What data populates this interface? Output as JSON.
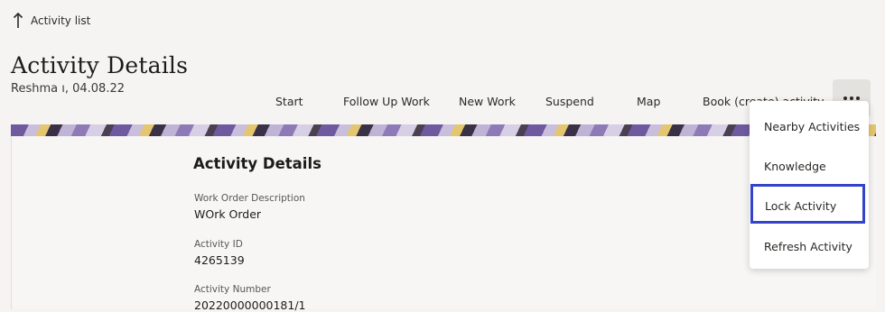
{
  "nav": {
    "up_label": "Activity list"
  },
  "header": {
    "title": "Activity Details",
    "subtitle": "Reshma ı, 04.08.22"
  },
  "actions": {
    "start": "Start",
    "follow_up": "Follow Up Work",
    "new_work": "New Work",
    "suspend": "Suspend",
    "map": "Map",
    "book": "Book (create) activity"
  },
  "menu": {
    "items": [
      "Nearby Activities",
      "Knowledge",
      "Lock Activity",
      "Refresh Activity"
    ],
    "highlight_color": "#3344c8"
  },
  "details": {
    "section_title": "Activity Details",
    "fields": [
      {
        "label": "Work Order Description",
        "value": "WOrk Order"
      },
      {
        "label": "Activity ID",
        "value": "4265139"
      },
      {
        "label": "Activity Number",
        "value": "20220000000181/1"
      }
    ]
  }
}
